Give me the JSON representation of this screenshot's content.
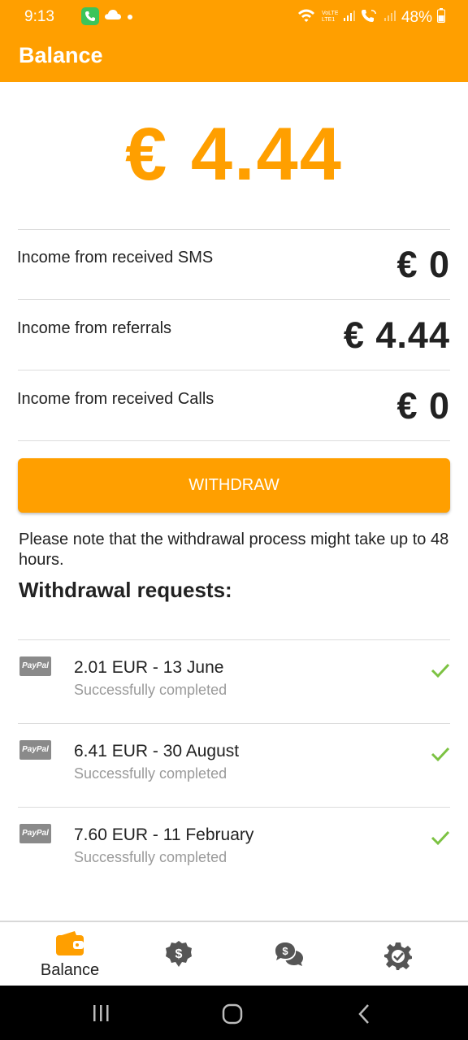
{
  "status_bar": {
    "time": "9:13",
    "battery": "48%",
    "icons": [
      "phone-app-icon",
      "cloud-icon",
      "dot-icon",
      "wifi-icon",
      "volte-icon",
      "signal-icon",
      "wifi-call-icon",
      "signal-icon",
      "battery-icon"
    ]
  },
  "app_bar": {
    "title": "Balance"
  },
  "balance": {
    "amount": "€ 4.44"
  },
  "income": [
    {
      "label": "Income from received SMS",
      "value": "€ 0"
    },
    {
      "label": "Income from referrals",
      "value": "€ 4.44"
    },
    {
      "label": "Income from received Calls",
      "value": "€ 0"
    }
  ],
  "withdraw_button": "WITHDRAW",
  "note": "Please note that the withdrawal process might take up to 48 hours.",
  "requests_title": "Withdrawal requests:",
  "requests": [
    {
      "method": "PayPal",
      "amount": "2.01 EUR - 13 June",
      "status": "Successfully completed"
    },
    {
      "method": "PayPal",
      "amount": "6.41 EUR - 30 August",
      "status": "Successfully completed"
    },
    {
      "method": "PayPal",
      "amount": "7.60 EUR - 11 February",
      "status": "Successfully completed"
    }
  ],
  "bottom_nav": [
    {
      "label": "Balance",
      "icon": "wallet-icon",
      "active": true
    },
    {
      "label": "",
      "icon": "dollar-badge-icon"
    },
    {
      "label": "",
      "icon": "chat-money-icon"
    },
    {
      "label": "",
      "icon": "settings-gear-icon"
    }
  ],
  "colors": {
    "accent": "#ff9f00",
    "check": "#7cc242",
    "text": "#222222",
    "muted": "#9a9a9a"
  }
}
